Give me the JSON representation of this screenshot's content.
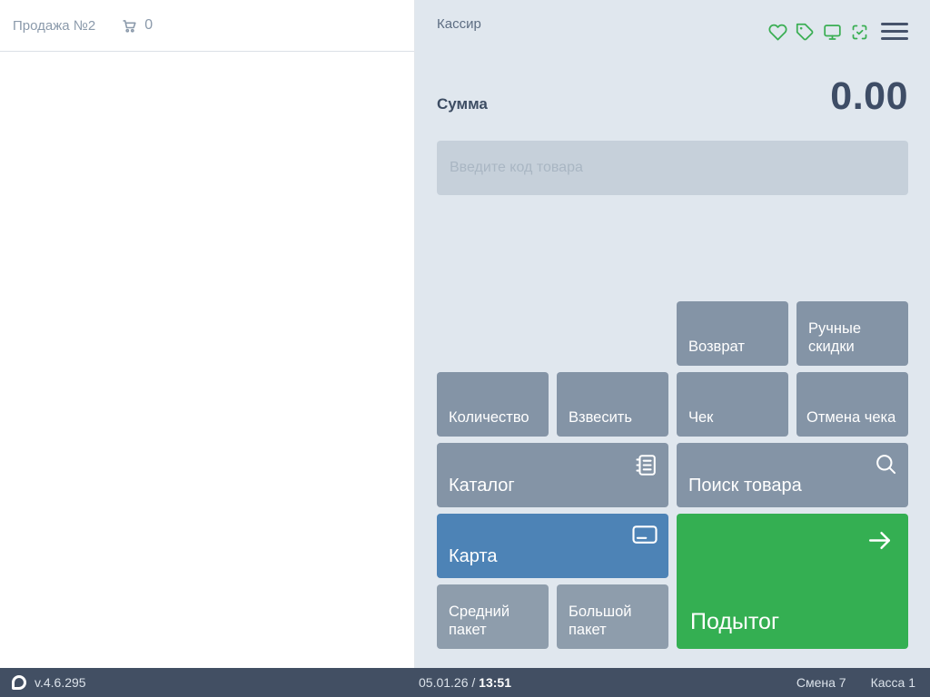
{
  "left_panel": {
    "title": "Продажа №2",
    "cart_count": "0"
  },
  "right_panel": {
    "cashier_label": "Кассир",
    "sum_label": "Сумма",
    "sum_value": "0.00",
    "input_placeholder": "Введите код товара",
    "buttons": {
      "vozvrat": "Возврат",
      "ruchnye_skidki": "Ручные скидки",
      "kolichestvo": "Количество",
      "vzvesit": "Взвесить",
      "chek": "Чек",
      "otmena_cheka": "Отмена чека",
      "katalog": "Каталог",
      "poisk_tovara": "Поиск товара",
      "karta": "Карта",
      "podytog": "Подытог",
      "sredniy_paket": "Средний пакет",
      "bolshoy_paket": "Большой пакет"
    }
  },
  "status_bar": {
    "version": "v.4.6.295",
    "date_prefix": "05.01.26 /",
    "time": "13:51",
    "shift": "Смена 7",
    "register": "Касса 1"
  },
  "icons": {
    "header": [
      "heart-icon",
      "tag-icon",
      "monitor-icon",
      "scan-check-icon",
      "menu-icon"
    ],
    "cart": "cart-icon",
    "catalog_button": "catalog-icon",
    "search_button": "search-icon",
    "card_button": "card-icon",
    "subtotal_button": "arrow-right-icon",
    "logo": "app-logo"
  },
  "colors": {
    "accent_green": "#34af52",
    "button_gray": "#8494a6",
    "button_gray_light": "#8e9dac",
    "button_blue": "#4d83b6",
    "icon_green": "#3aae53",
    "panel_bg": "#e0e7ee",
    "input_bg": "#c6d0da",
    "statusbar_bg": "#424f63",
    "dark_text": "#3e4d66",
    "muted_text": "#8b9aab"
  }
}
